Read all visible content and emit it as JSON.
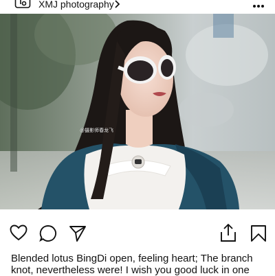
{
  "header": {
    "account_name": "XMJ  photography",
    "icons": {
      "logo": "photo-library-icon",
      "chevron": "chevron-right-icon",
      "more": "more-dots-icon"
    }
  },
  "post": {
    "watermark": "@摄影师春龙飞",
    "caption": "Blended lotus BingDi open, feeling heart; The branch knot, nevertheless were! I wish you good luck in one"
  },
  "actions": {
    "icons": [
      "heart-icon",
      "comment-bubble-icon",
      "send-icon",
      "upload-icon",
      "bookmark-icon"
    ]
  },
  "colors": {
    "coat": "#245268",
    "background": "#ffffff",
    "text": "#111111"
  }
}
